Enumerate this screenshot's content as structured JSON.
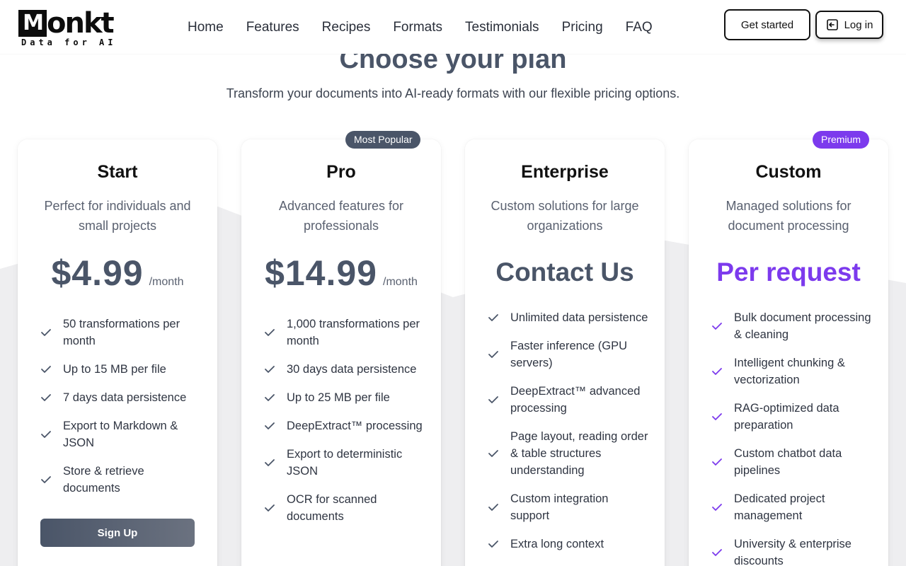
{
  "brand": {
    "name": "onkt",
    "mark": "M",
    "tagline": "Data for AI"
  },
  "nav": [
    "Home",
    "Features",
    "Recipes",
    "Formats",
    "Testimonials",
    "Pricing",
    "FAQ"
  ],
  "header": {
    "get_started": "Get started",
    "log_in": "Log in"
  },
  "pricing": {
    "title": "Choose your plan",
    "subtitle": "Transform your documents into AI-ready formats with our flexible pricing options."
  },
  "badges": {
    "popular": "Most Popular",
    "premium": "Premium"
  },
  "colors": {
    "accent_purple": "#7c3aed",
    "slate": "#4a5568",
    "popular_badge": "#4a5568"
  },
  "plans": [
    {
      "name": "Start",
      "description": "Perfect for individuals and small projects",
      "price": "$4.99",
      "period": "/month",
      "features": [
        "50 transformations per month",
        "Up to 15 MB per file",
        "7 days data persistence",
        "Export to Markdown & JSON",
        "Store & retrieve documents"
      ],
      "cta": "Sign Up"
    },
    {
      "name": "Pro",
      "description": "Advanced features for professionals",
      "price": "$14.99",
      "period": "/month",
      "features": [
        "1,000 transformations per month",
        "30 days data persistence",
        "Up to 25 MB per file",
        "DeepExtract™ processing",
        "Export to deterministic JSON",
        "OCR for scanned documents"
      ]
    },
    {
      "name": "Enterprise",
      "description": "Custom solutions for large organizations",
      "price": "Contact Us",
      "features": [
        "Unlimited data persistence",
        "Faster inference (GPU servers)",
        "DeepExtract™ advanced processing",
        "Page layout, reading order & table structures understanding",
        "Custom integration support",
        "Extra long context"
      ]
    },
    {
      "name": "Custom",
      "description": "Managed solutions for document processing",
      "price": "Per request",
      "features": [
        "Bulk document processing & cleaning",
        "Intelligent chunking & vectorization",
        "RAG-optimized data preparation",
        "Custom chatbot data pipelines",
        "Dedicated project management",
        "University & enterprise discounts"
      ]
    }
  ]
}
